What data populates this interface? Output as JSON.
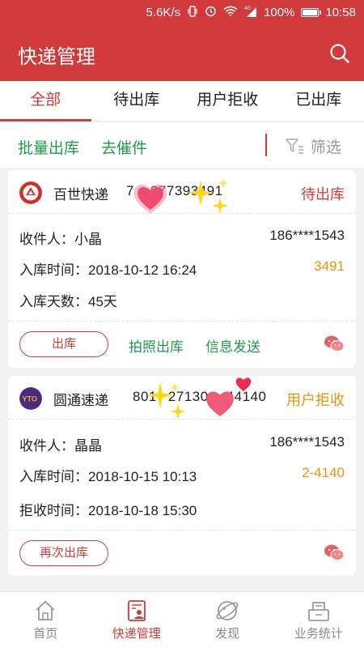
{
  "status_bar": {
    "speed": "5.6K/s",
    "battery": "100%",
    "battery_level": 1.0,
    "time": "10:58",
    "network": "4G"
  },
  "header": {
    "title": "快递管理"
  },
  "tabs": [
    {
      "label": "全部",
      "active": true
    },
    {
      "label": "待出库",
      "active": false
    },
    {
      "label": "用户拒收",
      "active": false
    },
    {
      "label": "已出库",
      "active": false
    }
  ],
  "actions": {
    "batch_out": "批量出库",
    "urge": "去催件",
    "filter": "筛选"
  },
  "parcels": [
    {
      "courier": "百世快递",
      "tracking_visible_start": "7",
      "tracking_visible_end": "977393491",
      "status": "待出库",
      "recipient_label": "收件人：",
      "recipient": "小晶",
      "phone": "186****1543",
      "time_label": "入库时间：",
      "time": "2018-10-12 16:24",
      "code": "3491",
      "extra_label": "入库天数：",
      "extra": "45天",
      "primary_action": "出库",
      "photo_action": "拍照出库",
      "message_action": "信息发送"
    },
    {
      "courier": "圆通速递",
      "tracking_visible_start": "801",
      "tracking_visible_mid": "27130",
      "tracking_visible_end": "44140",
      "status": "用户拒收",
      "recipient_label": "收件人：",
      "recipient": "晶晶",
      "phone": "186****1543",
      "time_label": "入库时间：",
      "time": "2018-10-15 10:13",
      "code": "2-4140",
      "extra_label": "拒收时间：",
      "extra": "2018-10-18 15:30",
      "primary_action": "再次出库"
    }
  ],
  "bottom_nav": [
    {
      "label": "首页",
      "icon": "home-icon",
      "active": false
    },
    {
      "label": "快递管理",
      "icon": "parcel-manage-icon",
      "active": true
    },
    {
      "label": "发现",
      "icon": "discover-icon",
      "active": false
    },
    {
      "label": "业务统计",
      "icon": "stats-icon",
      "active": false
    }
  ],
  "colors": {
    "brand": "#d13a3a",
    "green": "#1f9a4a",
    "orange": "#e8940c"
  }
}
